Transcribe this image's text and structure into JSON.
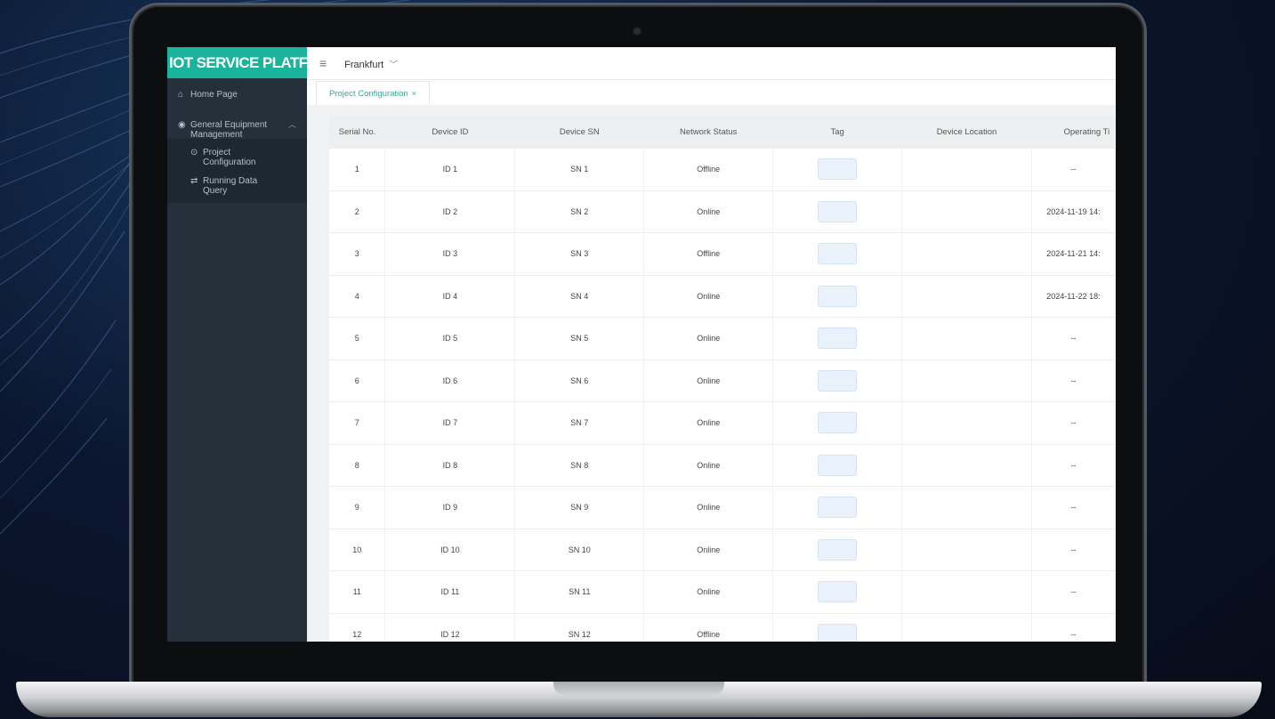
{
  "app": {
    "brand_title": "IOT SERVICE PLATFORM"
  },
  "sidebar": {
    "home_label": "Home Page",
    "group_label": "General Equipment Management",
    "sub_items": [
      {
        "label": "Project Configuration"
      },
      {
        "label": "Running Data Query"
      }
    ]
  },
  "topbar": {
    "region": "Frankfurt"
  },
  "tabs": [
    {
      "label": "Project Configuration",
      "close": "×"
    }
  ],
  "table": {
    "columns": [
      "Serial No.",
      "Device ID",
      "Device SN",
      "Network Status",
      "Tag",
      "Device Location",
      "Operating Ti"
    ],
    "rows": [
      {
        "serial": "1",
        "device_id": "ID 1",
        "device_sn": "SN 1",
        "status": "Offline",
        "location": "",
        "operating_time": "--"
      },
      {
        "serial": "2",
        "device_id": "ID 2",
        "device_sn": "SN 2",
        "status": "Online",
        "location": "",
        "operating_time": "2024-11-19 14:"
      },
      {
        "serial": "3",
        "device_id": "ID 3",
        "device_sn": "SN 3",
        "status": "Offline",
        "location": "",
        "operating_time": "2024-11-21 14:"
      },
      {
        "serial": "4",
        "device_id": "ID 4",
        "device_sn": "SN 4",
        "status": "Online",
        "location": "",
        "operating_time": "2024-11-22 18:"
      },
      {
        "serial": "5",
        "device_id": "ID 5",
        "device_sn": "SN 5",
        "status": "Online",
        "location": "",
        "operating_time": "--"
      },
      {
        "serial": "6",
        "device_id": "ID 6",
        "device_sn": "SN 6",
        "status": "Online",
        "location": "",
        "operating_time": "--"
      },
      {
        "serial": "7",
        "device_id": "ID 7",
        "device_sn": "SN 7",
        "status": "Online",
        "location": "",
        "operating_time": "--"
      },
      {
        "serial": "8",
        "device_id": "ID 8",
        "device_sn": "SN 8",
        "status": "Online",
        "location": "",
        "operating_time": "--"
      },
      {
        "serial": "9",
        "device_id": "ID 9",
        "device_sn": "SN 9",
        "status": "Online",
        "location": "",
        "operating_time": "--"
      },
      {
        "serial": "10",
        "device_id": "ID 10",
        "device_sn": "SN 10",
        "status": "Online",
        "location": "",
        "operating_time": "--"
      },
      {
        "serial": "11",
        "device_id": "ID 11",
        "device_sn": "SN 11",
        "status": "Online",
        "location": "",
        "operating_time": "--"
      },
      {
        "serial": "12",
        "device_id": "ID 12",
        "device_sn": "SN 12",
        "status": "Offline",
        "location": "",
        "operating_time": "--"
      }
    ]
  },
  "colors": {
    "brand": "#1bb39b",
    "sidebar": "#25303a",
    "tag_fill": "#e9f1fb"
  }
}
